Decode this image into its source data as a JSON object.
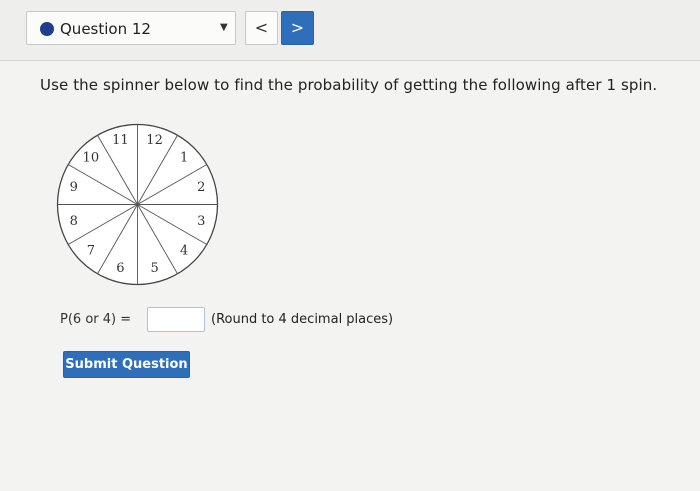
{
  "header": {
    "question_label": "Question 12",
    "dropdown_icon": "caret-down-icon",
    "prev_label": "<",
    "next_label": ">"
  },
  "prompt": "Use the spinner below to find the probability of getting the following after 1 spin.",
  "spinner": {
    "numbers": [
      "12",
      "1",
      "2",
      "3",
      "4",
      "5",
      "6",
      "7",
      "8",
      "9",
      "10",
      "11"
    ]
  },
  "answer": {
    "label": "P(6 or 4) =",
    "value": "",
    "hint": "(Round to 4 decimal places)"
  },
  "submit_label": "Submit Question",
  "colors": {
    "accent": "#2f6fba",
    "dot": "#1f3e8c"
  }
}
